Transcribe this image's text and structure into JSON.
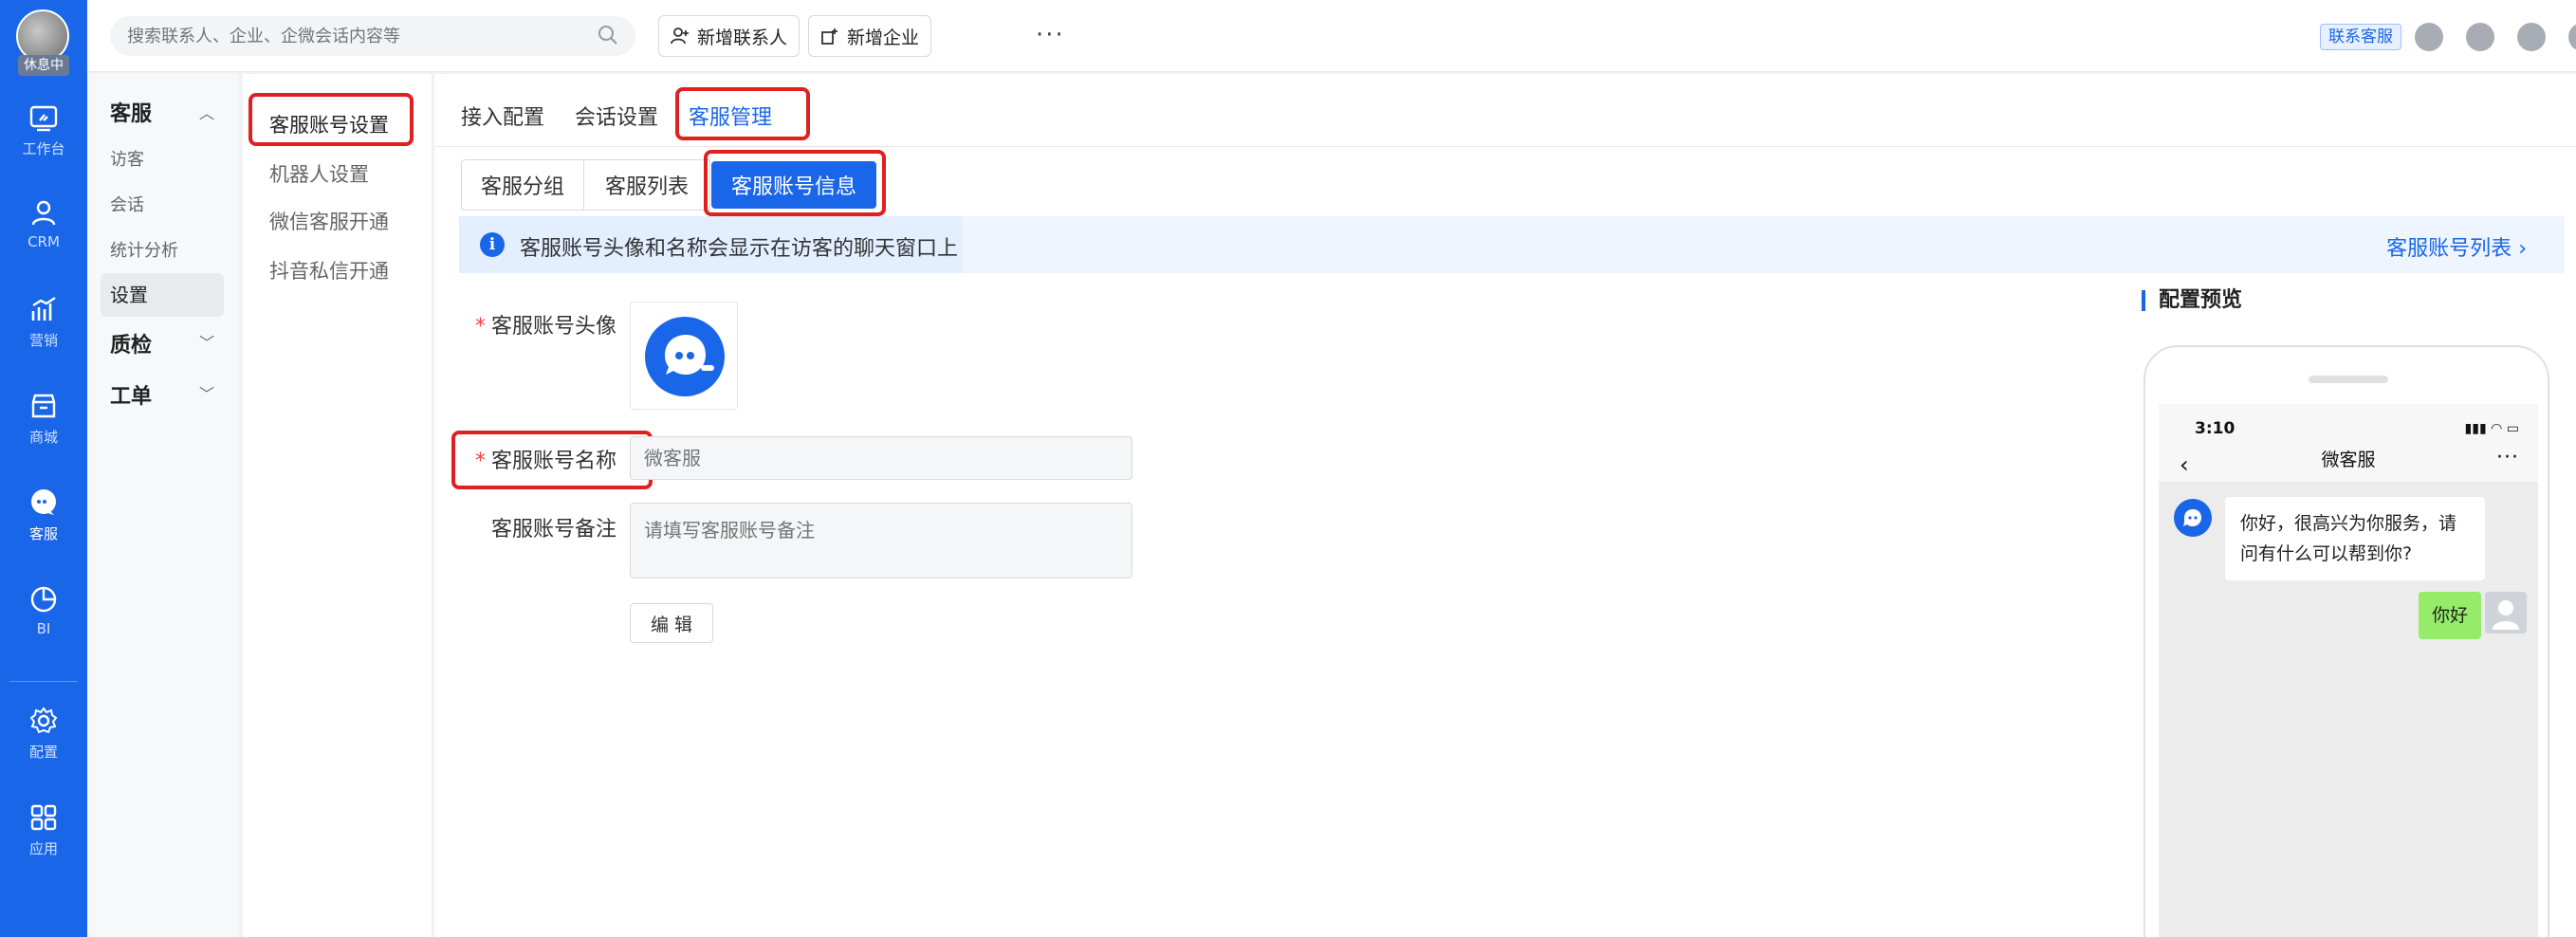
{
  "rail": {
    "status_badge": "休息中",
    "items": [
      {
        "label": "工作台",
        "icon": "dashboard-icon"
      },
      {
        "label": "CRM",
        "icon": "user-icon"
      },
      {
        "label": "营销",
        "icon": "chart-icon"
      },
      {
        "label": "商城",
        "icon": "store-icon"
      },
      {
        "label": "客服",
        "icon": "chat-icon"
      },
      {
        "label": "BI",
        "icon": "pie-icon"
      },
      {
        "label": "配置",
        "icon": "gear-icon"
      },
      {
        "label": "应用",
        "icon": "apps-icon"
      }
    ]
  },
  "topbar": {
    "search_placeholder": "搜索联系人、企业、企微会话内容等",
    "add_contact": "新增联系人",
    "add_company": "新增企业",
    "more": "···",
    "contact_service": "联系客服"
  },
  "nav2": {
    "section_service": "客服",
    "items": [
      "访客",
      "会话",
      "统计分析",
      "设置"
    ],
    "section_quality": "质检",
    "section_ticket": "工单"
  },
  "nav3": {
    "items": [
      "客服账号设置",
      "机器人设置",
      "微信客服开通",
      "抖音私信开通"
    ]
  },
  "main": {
    "tabs": [
      "接入配置",
      "会话设置",
      "客服管理"
    ],
    "segments": [
      "客服分组",
      "客服列表",
      "客服账号信息"
    ],
    "info_text": "客服账号头像和名称会显示在访客的聊天窗口上",
    "info_link": "客服账号列表",
    "form": {
      "avatar_label": "客服账号头像",
      "name_label": "客服账号名称",
      "name_placeholder": "微客服",
      "remark_label": "客服账号备注",
      "remark_placeholder": "请填写客服账号备注",
      "edit_button": "编 辑"
    }
  },
  "preview": {
    "title": "配置预览",
    "time": "3:10",
    "chat_title": "微客服",
    "incoming_message": "你好，很高兴为你服务，请问有什么可以帮到你?",
    "outgoing_message": "你好"
  },
  "colors": {
    "brand": "#1a66e8",
    "highlight": "#e02020",
    "outgoing_bubble": "#95ec69"
  }
}
